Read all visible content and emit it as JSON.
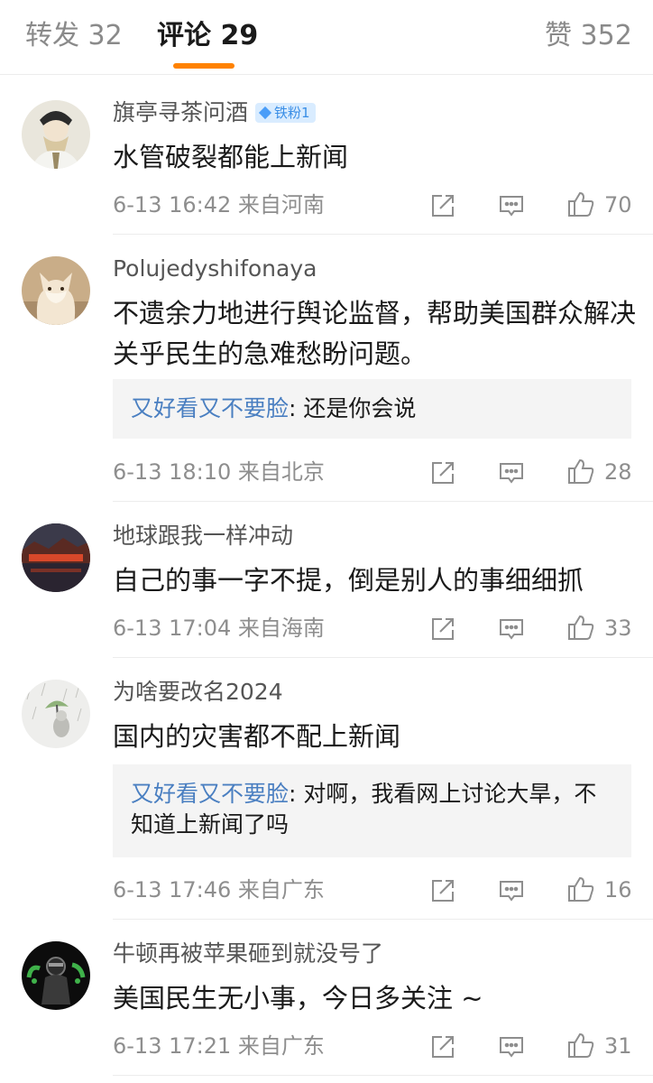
{
  "tabs": {
    "repost_label": "转发",
    "repost_count": "32",
    "comment_label": "评论",
    "comment_count": "29",
    "like_label": "赞",
    "like_count": "352"
  },
  "accent_color": "#ff8200",
  "comments": [
    {
      "username": "旗亭寻茶问酒",
      "badge": "铁粉1",
      "text": "水管破裂都能上新闻",
      "time": "6-13 16:42",
      "location": "来自河南",
      "likes": "70"
    },
    {
      "username": "Polujedyshifonaya",
      "text": "不遗余力地进行舆论监督，帮助美国群众解决关乎民生的急难愁盼问题。",
      "reply_user": "又好看又不要脸",
      "reply_text": ": 还是你会说",
      "time": "6-13 18:10",
      "location": "来自北京",
      "likes": "28"
    },
    {
      "username": "地球跟我一样冲动",
      "text": "自己的事一字不提，倒是别人的事细细抓",
      "time": "6-13 17:04",
      "location": "来自海南",
      "likes": "33"
    },
    {
      "username": "为啥要改名2024",
      "text": "国内的灾害都不配上新闻",
      "reply_user": "又好看又不要脸",
      "reply_text": ": 对啊，我看网上讨论大旱，不知道上新闻了吗",
      "time": "6-13 17:46",
      "location": "来自广东",
      "likes": "16"
    },
    {
      "username": "牛顿再被苹果砸到就没号了",
      "text": "美国民生无小事，今日多关注 ~",
      "time": "6-13 17:21",
      "location": "来自广东",
      "likes": "31"
    }
  ]
}
